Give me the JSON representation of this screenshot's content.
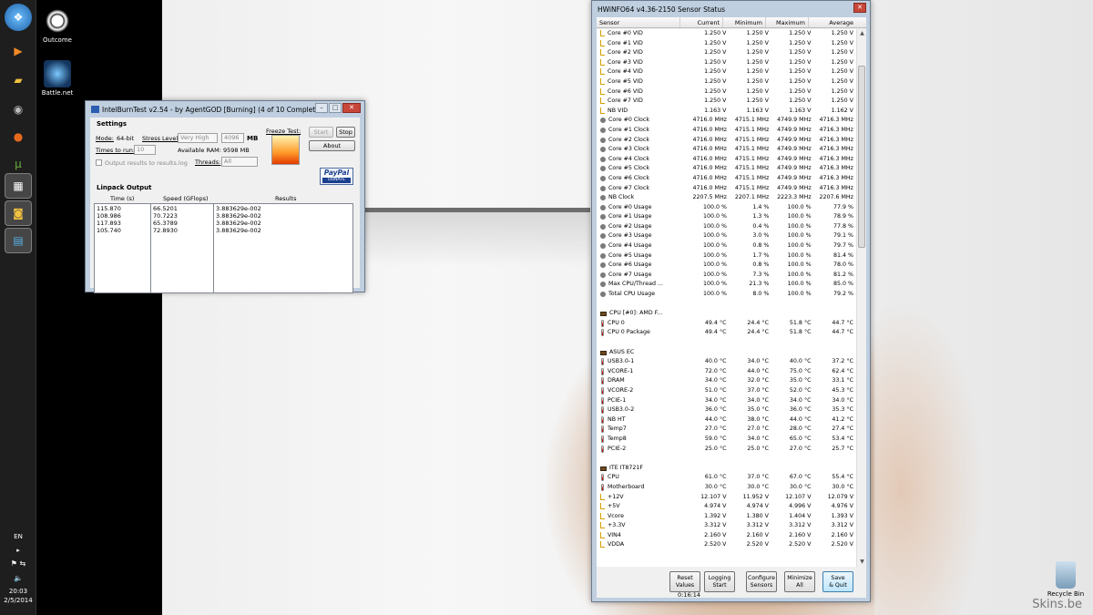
{
  "desktop": {
    "icons": [
      {
        "label": "Outcome",
        "icon": "gear-icon"
      },
      {
        "label": "Battle.net",
        "icon": "battlenet-icon"
      }
    ],
    "recycle_bin": "Recycle Bin",
    "watermark": "Skins.be"
  },
  "taskbar": {
    "language": "EN",
    "time": "20:03",
    "date": "2/5/2014"
  },
  "ibt": {
    "title": "IntelBurnTest v2.54 - by AgentGOD [Burning] (4 of 10 Completed)",
    "settings_label": "Settings",
    "mode_label": "Mode:",
    "mode_value": "64-bit",
    "stress_label": "Stress Level:",
    "stress_value": "Very High",
    "mb_value": "4096",
    "mb_unit": "MB",
    "times_label": "Times to run:",
    "times_value": "10",
    "ram_label": "Available RAM:",
    "ram_value": "9598 MB",
    "threads_label": "Threads:",
    "threads_value": "All",
    "output_checkbox": "Output results to results.log",
    "freeze_label": "Freeze Test:",
    "start_btn": "Start",
    "stop_btn": "Stop",
    "about_btn": "About",
    "paypal": "PayPal",
    "donate": "DONATE",
    "linpack_label": "Linpack Output",
    "columns": [
      "Time (s)",
      "Speed (GFlops)",
      "Results"
    ],
    "rows": [
      [
        "115.870",
        "66.5201",
        "3.883629e-002"
      ],
      [
        "108.986",
        "70.7223",
        "3.883629e-002"
      ],
      [
        "117.893",
        "65.3789",
        "3.883629e-002"
      ],
      [
        "105.740",
        "72.8930",
        "3.883629e-002"
      ]
    ]
  },
  "hw": {
    "title": "HWiNFO64 v4.36-2150 Sensor Status",
    "columns": [
      "Sensor",
      "Current",
      "Minimum",
      "Maximum",
      "Average"
    ],
    "rows": [
      {
        "t": "volt",
        "n": "Core #0 VID",
        "c": "1.250 V",
        "mi": "1.250 V",
        "ma": "1.250 V",
        "a": "1.250 V"
      },
      {
        "t": "volt",
        "n": "Core #1 VID",
        "c": "1.250 V",
        "mi": "1.250 V",
        "ma": "1.250 V",
        "a": "1.250 V"
      },
      {
        "t": "volt",
        "n": "Core #2 VID",
        "c": "1.250 V",
        "mi": "1.250 V",
        "ma": "1.250 V",
        "a": "1.250 V"
      },
      {
        "t": "volt",
        "n": "Core #3 VID",
        "c": "1.250 V",
        "mi": "1.250 V",
        "ma": "1.250 V",
        "a": "1.250 V"
      },
      {
        "t": "volt",
        "n": "Core #4 VID",
        "c": "1.250 V",
        "mi": "1.250 V",
        "ma": "1.250 V",
        "a": "1.250 V"
      },
      {
        "t": "volt",
        "n": "Core #5 VID",
        "c": "1.250 V",
        "mi": "1.250 V",
        "ma": "1.250 V",
        "a": "1.250 V"
      },
      {
        "t": "volt",
        "n": "Core #6 VID",
        "c": "1.250 V",
        "mi": "1.250 V",
        "ma": "1.250 V",
        "a": "1.250 V"
      },
      {
        "t": "volt",
        "n": "Core #7 VID",
        "c": "1.250 V",
        "mi": "1.250 V",
        "ma": "1.250 V",
        "a": "1.250 V"
      },
      {
        "t": "volt",
        "n": "NB VID",
        "c": "1.163 V",
        "mi": "1.163 V",
        "ma": "1.163 V",
        "a": "1.162 V"
      },
      {
        "t": "clock",
        "n": "Core #0 Clock",
        "c": "4716.0 MHz",
        "mi": "4715.1 MHz",
        "ma": "4749.9 MHz",
        "a": "4716.3 MHz"
      },
      {
        "t": "clock",
        "n": "Core #1 Clock",
        "c": "4716.0 MHz",
        "mi": "4715.1 MHz",
        "ma": "4749.9 MHz",
        "a": "4716.3 MHz"
      },
      {
        "t": "clock",
        "n": "Core #2 Clock",
        "c": "4716.0 MHz",
        "mi": "4715.1 MHz",
        "ma": "4749.9 MHz",
        "a": "4716.3 MHz"
      },
      {
        "t": "clock",
        "n": "Core #3 Clock",
        "c": "4716.0 MHz",
        "mi": "4715.1 MHz",
        "ma": "4749.9 MHz",
        "a": "4716.3 MHz"
      },
      {
        "t": "clock",
        "n": "Core #4 Clock",
        "c": "4716.0 MHz",
        "mi": "4715.1 MHz",
        "ma": "4749.9 MHz",
        "a": "4716.3 MHz"
      },
      {
        "t": "clock",
        "n": "Core #5 Clock",
        "c": "4716.0 MHz",
        "mi": "4715.1 MHz",
        "ma": "4749.9 MHz",
        "a": "4716.3 MHz"
      },
      {
        "t": "clock",
        "n": "Core #6 Clock",
        "c": "4716.0 MHz",
        "mi": "4715.1 MHz",
        "ma": "4749.9 MHz",
        "a": "4716.3 MHz"
      },
      {
        "t": "clock",
        "n": "Core #7 Clock",
        "c": "4716.0 MHz",
        "mi": "4715.1 MHz",
        "ma": "4749.9 MHz",
        "a": "4716.3 MHz"
      },
      {
        "t": "clock",
        "n": "NB Clock",
        "c": "2207.5 MHz",
        "mi": "2207.1 MHz",
        "ma": "2223.3 MHz",
        "a": "2207.6 MHz"
      },
      {
        "t": "usage",
        "n": "Core #0 Usage",
        "c": "100.0 %",
        "mi": "1.4 %",
        "ma": "100.0 %",
        "a": "77.9 %"
      },
      {
        "t": "usage",
        "n": "Core #1 Usage",
        "c": "100.0 %",
        "mi": "1.3 %",
        "ma": "100.0 %",
        "a": "78.9 %"
      },
      {
        "t": "usage",
        "n": "Core #2 Usage",
        "c": "100.0 %",
        "mi": "0.4 %",
        "ma": "100.0 %",
        "a": "77.8 %"
      },
      {
        "t": "usage",
        "n": "Core #3 Usage",
        "c": "100.0 %",
        "mi": "3.0 %",
        "ma": "100.0 %",
        "a": "79.1 %"
      },
      {
        "t": "usage",
        "n": "Core #4 Usage",
        "c": "100.0 %",
        "mi": "0.8 %",
        "ma": "100.0 %",
        "a": "79.7 %"
      },
      {
        "t": "usage",
        "n": "Core #5 Usage",
        "c": "100.0 %",
        "mi": "1.7 %",
        "ma": "100.0 %",
        "a": "81.4 %"
      },
      {
        "t": "usage",
        "n": "Core #6 Usage",
        "c": "100.0 %",
        "mi": "0.8 %",
        "ma": "100.0 %",
        "a": "78.0 %"
      },
      {
        "t": "usage",
        "n": "Core #7 Usage",
        "c": "100.0 %",
        "mi": "7.3 %",
        "ma": "100.0 %",
        "a": "81.2 %"
      },
      {
        "t": "usage",
        "n": "Max CPU/Thread ...",
        "c": "100.0 %",
        "mi": "21.3 %",
        "ma": "100.0 %",
        "a": "85.0 %"
      },
      {
        "t": "usage",
        "n": "Total CPU Usage",
        "c": "100.0 %",
        "mi": "8.0 %",
        "ma": "100.0 %",
        "a": "79.2 %"
      },
      {
        "t": "gap",
        "n": "",
        "c": "",
        "mi": "",
        "ma": "",
        "a": ""
      },
      {
        "t": "group",
        "n": "CPU [#0]: AMD F...",
        "c": "",
        "mi": "",
        "ma": "",
        "a": ""
      },
      {
        "t": "temp",
        "n": "CPU 0",
        "c": "49.4 °C",
        "mi": "24.4 °C",
        "ma": "51.8 °C",
        "a": "44.7 °C"
      },
      {
        "t": "temp",
        "n": "CPU 0 Package",
        "c": "49.4 °C",
        "mi": "24.4 °C",
        "ma": "51.8 °C",
        "a": "44.7 °C"
      },
      {
        "t": "gap",
        "n": "",
        "c": "",
        "mi": "",
        "ma": "",
        "a": ""
      },
      {
        "t": "group",
        "n": "ASUS EC",
        "c": "",
        "mi": "",
        "ma": "",
        "a": ""
      },
      {
        "t": "temp",
        "n": "USB3.0-1",
        "c": "40.0 °C",
        "mi": "34.0 °C",
        "ma": "40.0 °C",
        "a": "37.2 °C"
      },
      {
        "t": "temp",
        "n": "VCORE-1",
        "c": "72.0 °C",
        "mi": "44.0 °C",
        "ma": "75.0 °C",
        "a": "62.4 °C"
      },
      {
        "t": "temp",
        "n": "DRAM",
        "c": "34.0 °C",
        "mi": "32.0 °C",
        "ma": "35.0 °C",
        "a": "33.1 °C"
      },
      {
        "t": "temp",
        "n": "VCORE-2",
        "c": "51.0 °C",
        "mi": "37.0 °C",
        "ma": "52.0 °C",
        "a": "45.3 °C"
      },
      {
        "t": "temp",
        "n": "PCIE-1",
        "c": "34.0 °C",
        "mi": "34.0 °C",
        "ma": "34.0 °C",
        "a": "34.0 °C"
      },
      {
        "t": "temp",
        "n": "USB3.0-2",
        "c": "36.0 °C",
        "mi": "35.0 °C",
        "ma": "36.0 °C",
        "a": "35.3 °C"
      },
      {
        "t": "temp",
        "n": "NB HT",
        "c": "44.0 °C",
        "mi": "38.0 °C",
        "ma": "44.0 °C",
        "a": "41.2 °C"
      },
      {
        "t": "temp",
        "n": "Temp7",
        "c": "27.0 °C",
        "mi": "27.0 °C",
        "ma": "28.0 °C",
        "a": "27.4 °C"
      },
      {
        "t": "temp",
        "n": "Temp8",
        "c": "59.0 °C",
        "mi": "34.0 °C",
        "ma": "65.0 °C",
        "a": "53.4 °C"
      },
      {
        "t": "temp",
        "n": "PCIE-2",
        "c": "25.0 °C",
        "mi": "25.0 °C",
        "ma": "27.0 °C",
        "a": "25.7 °C"
      },
      {
        "t": "gap",
        "n": "",
        "c": "",
        "mi": "",
        "ma": "",
        "a": ""
      },
      {
        "t": "group",
        "n": "ITE IT8721F",
        "c": "",
        "mi": "",
        "ma": "",
        "a": ""
      },
      {
        "t": "temp",
        "n": "CPU",
        "c": "61.0 °C",
        "mi": "37.0 °C",
        "ma": "67.0 °C",
        "a": "55.4 °C"
      },
      {
        "t": "temp",
        "n": "Motherboard",
        "c": "30.0 °C",
        "mi": "30.0 °C",
        "ma": "30.0 °C",
        "a": "30.0 °C"
      },
      {
        "t": "volt",
        "n": "+12V",
        "c": "12.107 V",
        "mi": "11.952 V",
        "ma": "12.107 V",
        "a": "12.079 V"
      },
      {
        "t": "volt",
        "n": "+5V",
        "c": "4.974 V",
        "mi": "4.974 V",
        "ma": "4.996 V",
        "a": "4.976 V"
      },
      {
        "t": "volt",
        "n": "Vcore",
        "c": "1.392 V",
        "mi": "1.380 V",
        "ma": "1.404 V",
        "a": "1.393 V"
      },
      {
        "t": "volt",
        "n": "+3.3V",
        "c": "3.312 V",
        "mi": "3.312 V",
        "ma": "3.312 V",
        "a": "3.312 V"
      },
      {
        "t": "volt",
        "n": "VIN4",
        "c": "2.160 V",
        "mi": "2.160 V",
        "ma": "2.160 V",
        "a": "2.160 V"
      },
      {
        "t": "volt",
        "n": "VDDA",
        "c": "2.520 V",
        "mi": "2.520 V",
        "ma": "2.520 V",
        "a": "2.520 V"
      }
    ],
    "buttons": [
      {
        "name": "reset-values-button",
        "label": "Reset\nValues"
      },
      {
        "name": "logging-start-button",
        "label": "Logging\nStart"
      },
      {
        "name": "configure-sensors-button",
        "label": "Configure\nSensors"
      },
      {
        "name": "minimize-all-button",
        "label": "Minimize\nAll"
      },
      {
        "name": "save-quit-button",
        "label": "Save\n& Quit"
      }
    ],
    "timer": "0:16:14"
  }
}
